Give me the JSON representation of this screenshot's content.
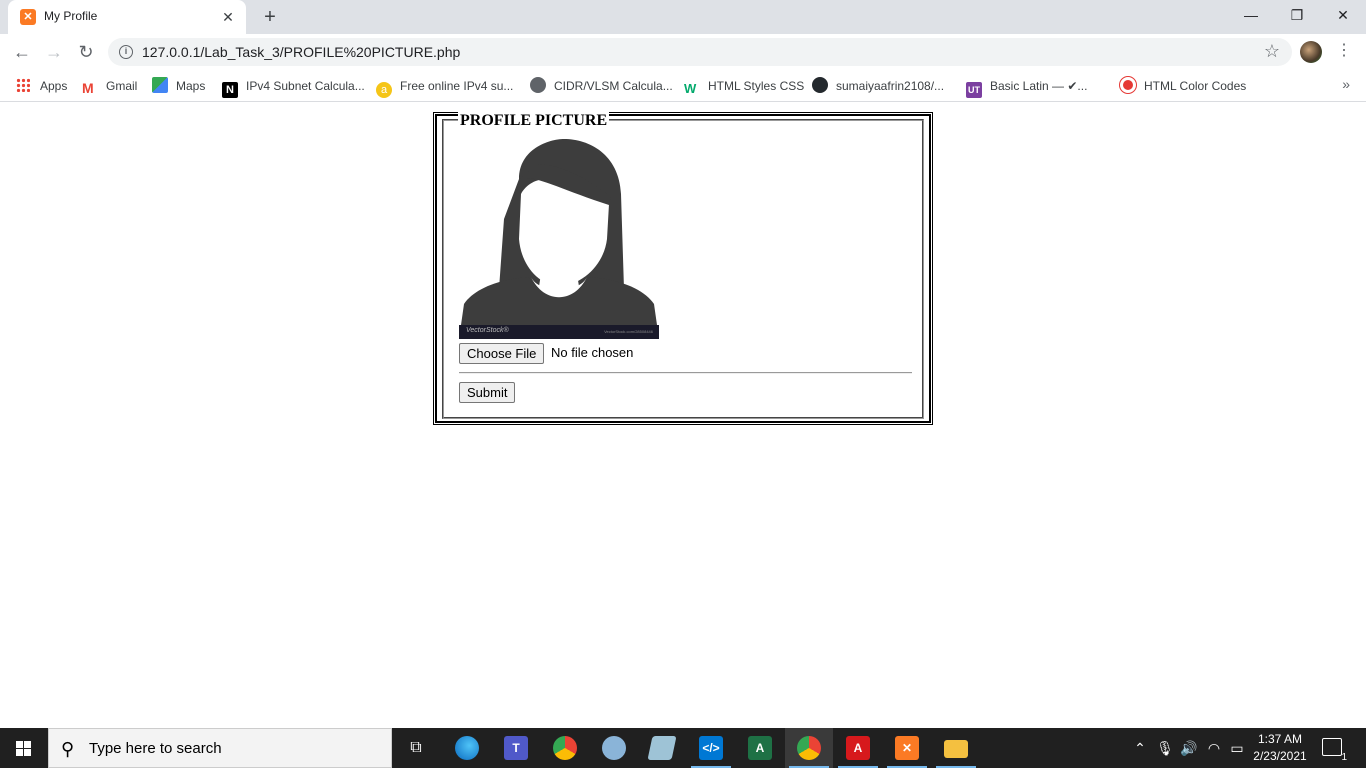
{
  "browser": {
    "tab": {
      "title": "My Profile",
      "favicon": "xampp-icon"
    },
    "address": "127.0.0.1/Lab_Task_3/PROFILE%20PICTURE.php",
    "bookmarks": [
      {
        "label": "Apps",
        "icon": "apps-grid-icon"
      },
      {
        "label": "Gmail",
        "icon": "gmail-icon"
      },
      {
        "label": "Maps",
        "icon": "maps-icon"
      },
      {
        "label": "IPv4 Subnet Calcula...",
        "icon": "notion-icon"
      },
      {
        "label": "Free online IPv4 su...",
        "icon": "subnet-icon"
      },
      {
        "label": "CIDR/VLSM Calcula...",
        "icon": "globe-icon"
      },
      {
        "label": "HTML Styles CSS",
        "icon": "w3schools-icon"
      },
      {
        "label": "sumaiyaafrin2108/...",
        "icon": "github-icon"
      },
      {
        "label": "Basic Latin — ✔...",
        "icon": "ut-icon"
      },
      {
        "label": "HTML Color Codes",
        "icon": "color-codes-icon"
      }
    ]
  },
  "page": {
    "legend": "PROFILE PICTURE",
    "image_watermark": "VectorStock®",
    "image_watermark_url": "VectorStock.com/28508446",
    "choose_file_label": "Choose File",
    "file_status": "No file chosen",
    "submit_label": "Submit"
  },
  "taskbar": {
    "search_placeholder": "Type here to search",
    "time": "1:37 AM",
    "date": "2/23/2021",
    "notification_count": "1"
  },
  "colors": {
    "tabstrip_bg": "#dee1e6",
    "taskbar_bg": "#202020",
    "avatar_fill": "#3d3d3d"
  }
}
